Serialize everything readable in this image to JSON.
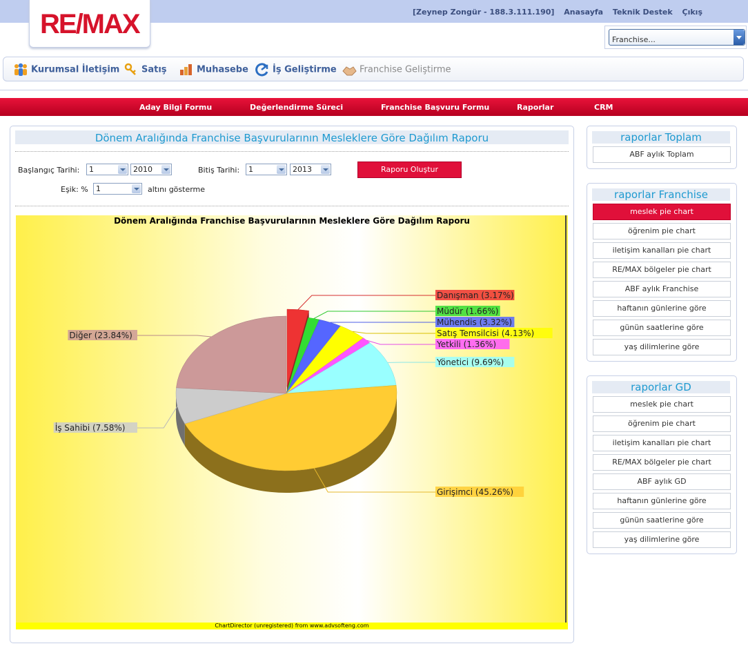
{
  "header": {
    "logo_text": "RE/MAX",
    "user": "[Zeynep Zongür - 188.3.111.190]",
    "links": [
      "Anasayfa",
      "Teknik Destek",
      "Çıkış"
    ],
    "franchise_select": "Franchise..."
  },
  "modules": [
    {
      "label": "Kurumsal İletişim",
      "icon": "people-icon"
    },
    {
      "label": "Satış",
      "icon": "key-icon"
    },
    {
      "label": "Muhasebe",
      "icon": "blocks-icon"
    },
    {
      "label": "İş Geliştirme",
      "icon": "growth-icon"
    },
    {
      "label": "Franchise Geliştirme",
      "icon": "handshake-icon"
    }
  ],
  "nav": [
    "Aday Bilgi Formu",
    "Değerlendirme Süreci",
    "Franchise Başvuru Formu",
    "Raporlar",
    "CRM"
  ],
  "report": {
    "title": "Dönem Aralığında Franchise Başvurularının Mesleklere Göre Dağılım Raporu",
    "start_label": "Başlangıç Tarihi:",
    "start_month": "1",
    "start_year": "2010",
    "end_label": "Bitiş Tarihi:",
    "end_month": "1",
    "end_year": "2013",
    "create_button": "Raporu Oluştur",
    "threshold_label": "Eşik: %",
    "threshold_value": "1",
    "threshold_suffix": "altını gösterme"
  },
  "chart_data": {
    "type": "pie",
    "title": "Dönem Aralığında Franchise Başvurularının Mesleklere Göre Dağılım Raporu",
    "slices": [
      {
        "label": "Danışman (3.17%)",
        "value": 3.17,
        "color": "#ee3333"
      },
      {
        "label": "Müdür (1.66%)",
        "value": 1.66,
        "color": "#33dd33"
      },
      {
        "label": "Mühendis (3.32%)",
        "value": 3.32,
        "color": "#5566ff"
      },
      {
        "label": "Satış Temsilcisi (4.13%)",
        "value": 4.13,
        "color": "#ffff00"
      },
      {
        "label": "Yetkili (1.36%)",
        "value": 1.36,
        "color": "#ff55ff"
      },
      {
        "label": "Yönetici (9.69%)",
        "value": 9.69,
        "color": "#99ffff"
      },
      {
        "label": "Girişimci (45.26%)",
        "value": 45.26,
        "color": "#ffcc33"
      },
      {
        "label": "İş Sahibi (7.58%)",
        "value": 7.58,
        "color": "#cccccc"
      },
      {
        "label": "Diğer (23.84%)",
        "value": 23.84,
        "color": "#cc9999"
      }
    ],
    "exploded": "Danışman (3.17%)",
    "footer": "ChartDirector (unregistered) from www.advsofteng.com"
  },
  "sidebar": [
    {
      "title": "raporlar Toplam",
      "items": [
        "ABF aylık Toplam"
      ],
      "active": -1
    },
    {
      "title": "raporlar Franchise",
      "items": [
        "meslek pie chart",
        "öğrenim pie chart",
        "iletişim kanalları pie chart",
        "RE/MAX bölgeler pie chart",
        "ABF aylık Franchise",
        "haftanın günlerine göre",
        "günün saatlerine göre",
        "yaş dilimlerine göre"
      ],
      "active": 0
    },
    {
      "title": "raporlar GD",
      "items": [
        "meslek pie chart",
        "öğrenim pie chart",
        "iletişim kanalları pie chart",
        "RE/MAX bölgeler pie chart",
        "ABF aylık GD",
        "haftanın günlerine göre",
        "günün saatlerine göre",
        "yaş dilimlerine göre"
      ],
      "active": -1
    }
  ]
}
